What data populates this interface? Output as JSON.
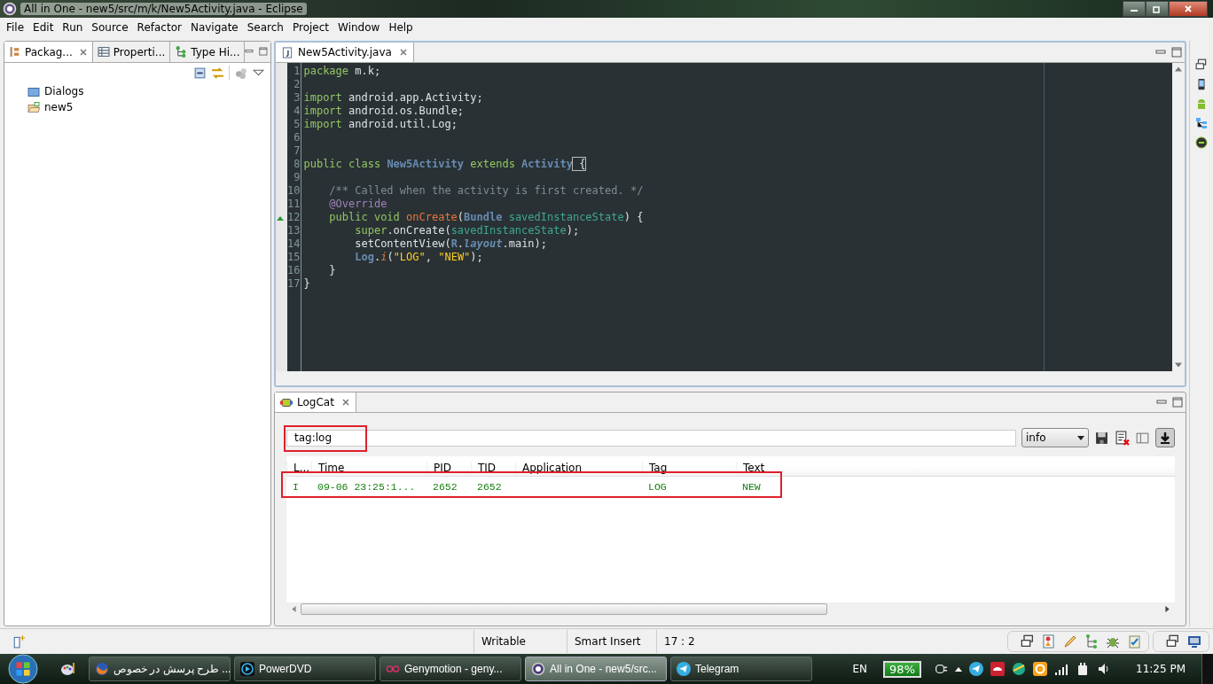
{
  "window": {
    "title": "All in One - new5/src/m/k/New5Activity.java - Eclipse"
  },
  "menu": [
    "File",
    "Edit",
    "Run",
    "Source",
    "Refactor",
    "Navigate",
    "Search",
    "Project",
    "Window",
    "Help"
  ],
  "left_panel": {
    "tabs": [
      {
        "label": "Packag...",
        "selected": true,
        "kind": "package"
      },
      {
        "label": "Properti...",
        "selected": false,
        "kind": "properties"
      },
      {
        "label": "Type Hi...",
        "selected": false,
        "kind": "hierarchy"
      }
    ],
    "tree": [
      {
        "label": "Dialogs",
        "kind": "folder"
      },
      {
        "label": "new5",
        "kind": "project"
      }
    ]
  },
  "editor": {
    "tabs": [
      {
        "label": "New5Activity.java",
        "selected": true
      }
    ],
    "lines": [
      {
        "number": "1",
        "marker": false,
        "tokens": [
          {
            "text": "package",
            "kind": "keyword"
          },
          {
            "text": " m.k;",
            "kind": "plain"
          }
        ]
      },
      {
        "number": "2",
        "marker": false
      },
      {
        "number": "3",
        "marker": false,
        "tokens": [
          {
            "text": "import",
            "kind": "keyword"
          },
          {
            "text": " android.app.Activity;",
            "kind": "plain"
          }
        ]
      },
      {
        "number": "4",
        "marker": false,
        "tokens": [
          {
            "text": "import",
            "kind": "keyword"
          },
          {
            "text": " android.os.Bundle;",
            "kind": "plain"
          }
        ]
      },
      {
        "number": "5",
        "marker": false,
        "tokens": [
          {
            "text": "import",
            "kind": "keyword"
          },
          {
            "text": " android.util.Log;",
            "kind": "plain"
          }
        ]
      },
      {
        "number": "6",
        "marker": false
      },
      {
        "number": "7",
        "marker": false
      },
      {
        "number": "8",
        "marker": false,
        "tokens": [
          {
            "text": "public class ",
            "kind": "keyword"
          },
          {
            "text": "New5Activity",
            "kind": "type"
          },
          {
            "text": " extends ",
            "kind": "keyword"
          },
          {
            "text": "Activity",
            "kind": "type"
          },
          {
            "text": " {",
            "kind": "bracket"
          }
        ]
      },
      {
        "number": "9",
        "marker": false
      },
      {
        "number": "10",
        "marker": false,
        "tokens": [
          {
            "text": "    /** Called when the activity is first created. */",
            "kind": "comment"
          }
        ]
      },
      {
        "number": "11",
        "marker": false,
        "tokens": [
          {
            "text": "    @Override",
            "kind": "annotation"
          }
        ]
      },
      {
        "number": "12",
        "marker": true,
        "tokens": [
          {
            "text": "    public void ",
            "kind": "keyword"
          },
          {
            "text": "onCreate",
            "kind": "method"
          },
          {
            "text": "(",
            "kind": "plain"
          },
          {
            "text": "Bundle",
            "kind": "type"
          },
          {
            "text": " savedInstanceState",
            "kind": "param"
          },
          {
            "text": ") {",
            "kind": "plain"
          }
        ]
      },
      {
        "number": "13",
        "marker": false,
        "tokens": [
          {
            "text": "        super",
            "kind": "keyword"
          },
          {
            "text": ".onCreate(",
            "kind": "plain"
          },
          {
            "text": "savedInstanceState",
            "kind": "param"
          },
          {
            "text": ");",
            "kind": "plain"
          }
        ]
      },
      {
        "number": "14",
        "marker": false,
        "tokens": [
          {
            "text": "        setContentView(",
            "kind": "plain"
          },
          {
            "text": "R",
            "kind": "type"
          },
          {
            "text": ".",
            "kind": "plain"
          },
          {
            "text": "layout",
            "kind": "field"
          },
          {
            "text": ".main);",
            "kind": "plain"
          }
        ]
      },
      {
        "number": "15",
        "marker": false,
        "tokens": [
          {
            "text": "        Log",
            "kind": "type"
          },
          {
            "text": ".",
            "kind": "plain"
          },
          {
            "text": "i",
            "kind": "static"
          },
          {
            "text": "(",
            "kind": "plain"
          },
          {
            "text": "\"LOG\"",
            "kind": "string"
          },
          {
            "text": ", ",
            "kind": "plain"
          },
          {
            "text": "\"NEW\"",
            "kind": "string"
          },
          {
            "text": ");",
            "kind": "plain"
          }
        ]
      },
      {
        "number": "16",
        "marker": false,
        "tokens": [
          {
            "text": "    }",
            "kind": "plain"
          }
        ]
      },
      {
        "number": "17",
        "marker": false,
        "tokens": [
          {
            "text": "}",
            "kind": "plain"
          }
        ]
      }
    ]
  },
  "logcat": {
    "tab": "LogCat",
    "filter": {
      "value": "tag:log",
      "highlighted": true
    },
    "level": "info",
    "columns": [
      "L...",
      "Time",
      "PID",
      "TID",
      "Application",
      "Tag",
      "Text"
    ],
    "rows": [
      {
        "cells": [
          "I",
          "09-06 23:25:1...",
          "2652",
          "2652",
          "",
          "LOG",
          "NEW"
        ],
        "highlighted": true
      }
    ]
  },
  "status_bar": {
    "items": [
      "Writable",
      "Smart Insert",
      "17 : 2"
    ]
  },
  "taskbar": {
    "buttons": [
      {
        "label": "طرح پرسش در خصوص ...",
        "kind": "firefox",
        "selected": false
      },
      {
        "label": "PowerDVD",
        "kind": "player",
        "selected": false
      },
      {
        "label": "Genymotion - geny...",
        "kind": "genymotion",
        "selected": false
      },
      {
        "label": "All in One - new5/src...",
        "kind": "eclipse",
        "selected": true
      },
      {
        "label": "Telegram",
        "kind": "telegram",
        "selected": false
      }
    ],
    "language": "EN",
    "battery": "98%",
    "clock": "11:25 PM"
  }
}
